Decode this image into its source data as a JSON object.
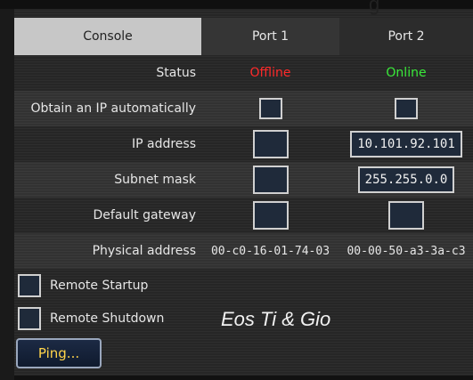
{
  "header": {
    "partial_title": "g"
  },
  "columns": {
    "console": "Console",
    "port1": "Port 1",
    "port2": "Port 2"
  },
  "rows": {
    "status": {
      "label": "Status",
      "port1": "Offline",
      "port2": "Online"
    },
    "obtain_ip": {
      "label": "Obtain an IP automatically",
      "port1_checked": false,
      "port2_checked": false
    },
    "ip_address": {
      "label": "IP address",
      "port1": "",
      "port2": "10.101.92.101"
    },
    "subnet_mask": {
      "label": "Subnet mask",
      "port1": "",
      "port2": "255.255.0.0"
    },
    "default_gateway": {
      "label": "Default gateway",
      "port1": "",
      "port2": ""
    },
    "physical_address": {
      "label": "Physical address",
      "port1": "00-c0-16-01-74-03",
      "port2": "00-00-50-a3-3a-c3"
    }
  },
  "options": {
    "remote_startup": {
      "label": "Remote Startup",
      "checked": false
    },
    "remote_shutdown": {
      "label": "Remote Shutdown",
      "checked": false
    }
  },
  "actions": {
    "ping_label": "Ping..."
  },
  "caption": "Eos Ti & Gio",
  "colors": {
    "offline": "#ff2a2a",
    "online": "#3aea3a",
    "ping_text": "#ffd44a",
    "header_active": "#c7c7c7"
  }
}
